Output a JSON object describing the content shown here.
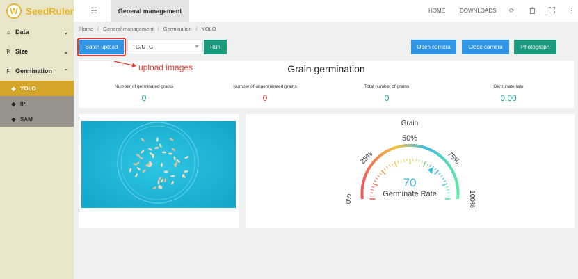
{
  "app": {
    "name": "SeedRuler",
    "logo_letter": "W"
  },
  "sidebar": {
    "items": [
      {
        "label": "Data",
        "icon": "home-icon",
        "chevron": "⌄"
      },
      {
        "label": "Size",
        "icon": "flag-icon",
        "chevron": "⌄"
      },
      {
        "label": "Germination",
        "icon": "flag-icon",
        "chevron": "⌃"
      }
    ],
    "subitems": [
      {
        "label": "YOLO",
        "icon": "tag-icon",
        "active": true
      },
      {
        "label": "IP",
        "icon": "tag-icon",
        "active": false
      },
      {
        "label": "SAM",
        "icon": "tag-icon",
        "active": false
      }
    ]
  },
  "topbar": {
    "tab_title": "General management",
    "links": {
      "home": "HOME",
      "downloads": "DOWNLOADS"
    }
  },
  "breadcrumb": {
    "home": "Home",
    "level1": "General management",
    "level2": "Germination",
    "level3": "YOLO"
  },
  "toolbar": {
    "batch_upload": "Batch upload",
    "select_value": "TG/UTG",
    "run": "Run",
    "open_camera": "Open camera",
    "close_camera": "Close camera",
    "photograph": "Photograph"
  },
  "annotation": {
    "text": "upload images"
  },
  "stats": {
    "title": "Grain germination",
    "items": [
      {
        "label": "Number of germinated grains",
        "value": "0",
        "color": "#1c9a8e"
      },
      {
        "label": "Number of ungerminated grains",
        "value": "0",
        "color": "#e03a2e"
      },
      {
        "label": "Total number of grains",
        "value": "0",
        "color": "#1c9a8e"
      },
      {
        "label": "Germinate rate",
        "value": "0.00",
        "color": "#1c9a8e"
      }
    ]
  },
  "gauge": {
    "title": "Grain",
    "value": "70",
    "value_label": "Germinate Rate",
    "ticks": {
      "t0": "0%",
      "t25": "25%",
      "t50": "50%",
      "t75": "75%",
      "t100": "100%"
    }
  }
}
